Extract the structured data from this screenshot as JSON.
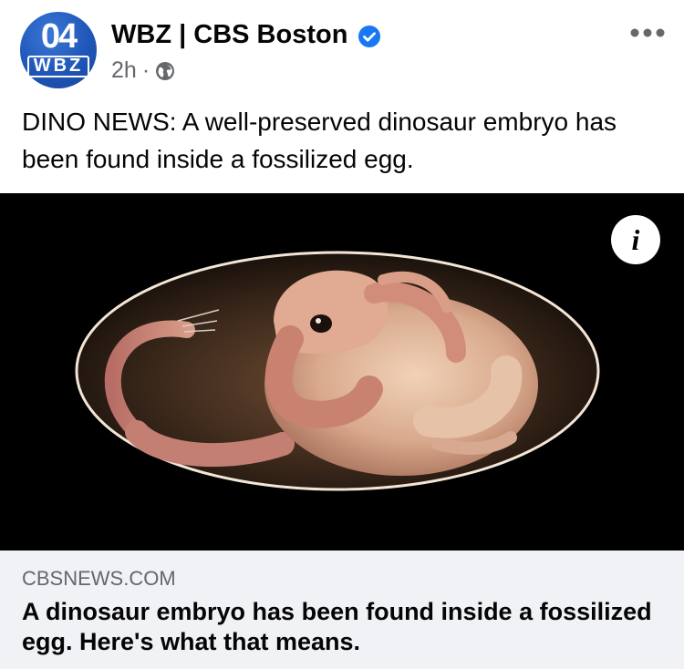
{
  "post": {
    "page_name": "WBZ | CBS Boston",
    "avatar_text_top": "04",
    "avatar_text_bottom": "WBZ",
    "time": "2h",
    "separator": "·",
    "privacy_icon": "globe-icon",
    "verified_icon": "verified-badge-icon",
    "more_icon": "more-options-icon",
    "caption": "DINO NEWS: A well-preserved dinosaur embryo has been found inside a fossilized egg.",
    "image_alt": "Illustration of a dinosaur embryo curled inside an egg",
    "info_icon_glyph": "i"
  },
  "link_preview": {
    "domain": "CBSNEWS.COM",
    "title": "A dinosaur embryo has been found inside a fossilized egg. Here's what that means."
  },
  "colors": {
    "accent": "#1877f2",
    "secondary_text": "#65676b",
    "link_box_bg": "#f0f2f5"
  }
}
